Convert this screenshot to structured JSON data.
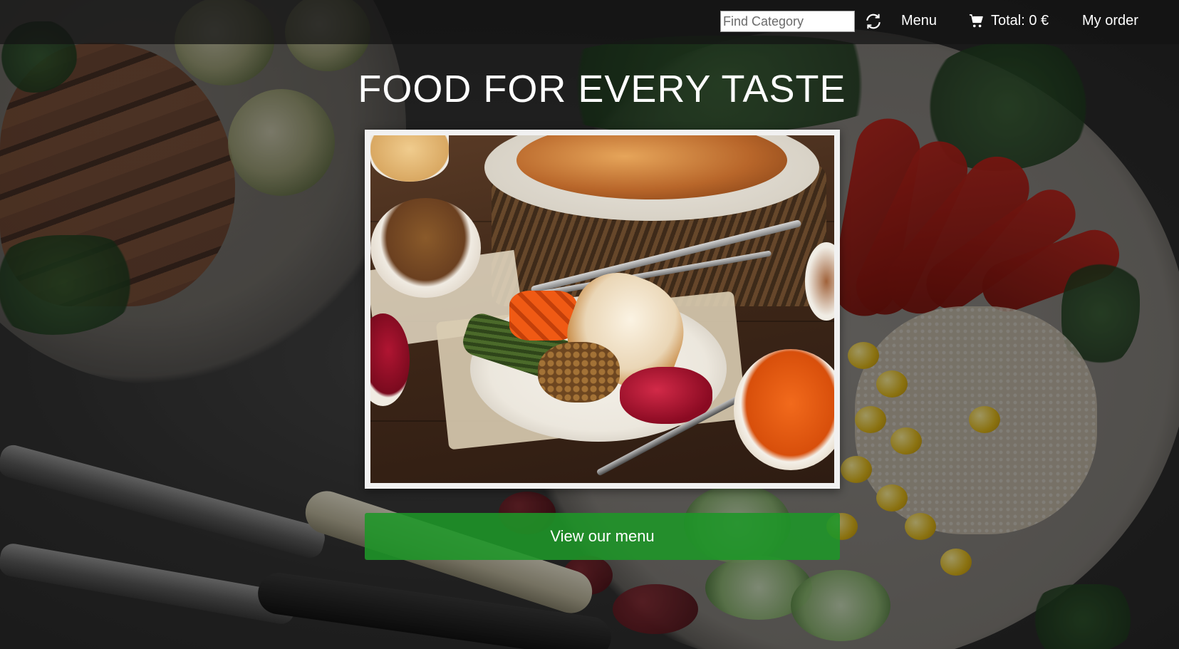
{
  "nav": {
    "search_placeholder": "Find Category",
    "refresh_icon": "refresh-icon",
    "menu_label": "Menu",
    "cart_icon": "cart-icon",
    "total_label": "Total: 0 €",
    "my_order_label": "My order"
  },
  "hero": {
    "title": "FOOD FOR EVERY TASTE",
    "image_subject": "roast turkey dinner",
    "cta_label": "View our menu"
  },
  "colors": {
    "cta_green": "#1e9628",
    "nav_bar": "#141414",
    "text": "#ffffff"
  }
}
